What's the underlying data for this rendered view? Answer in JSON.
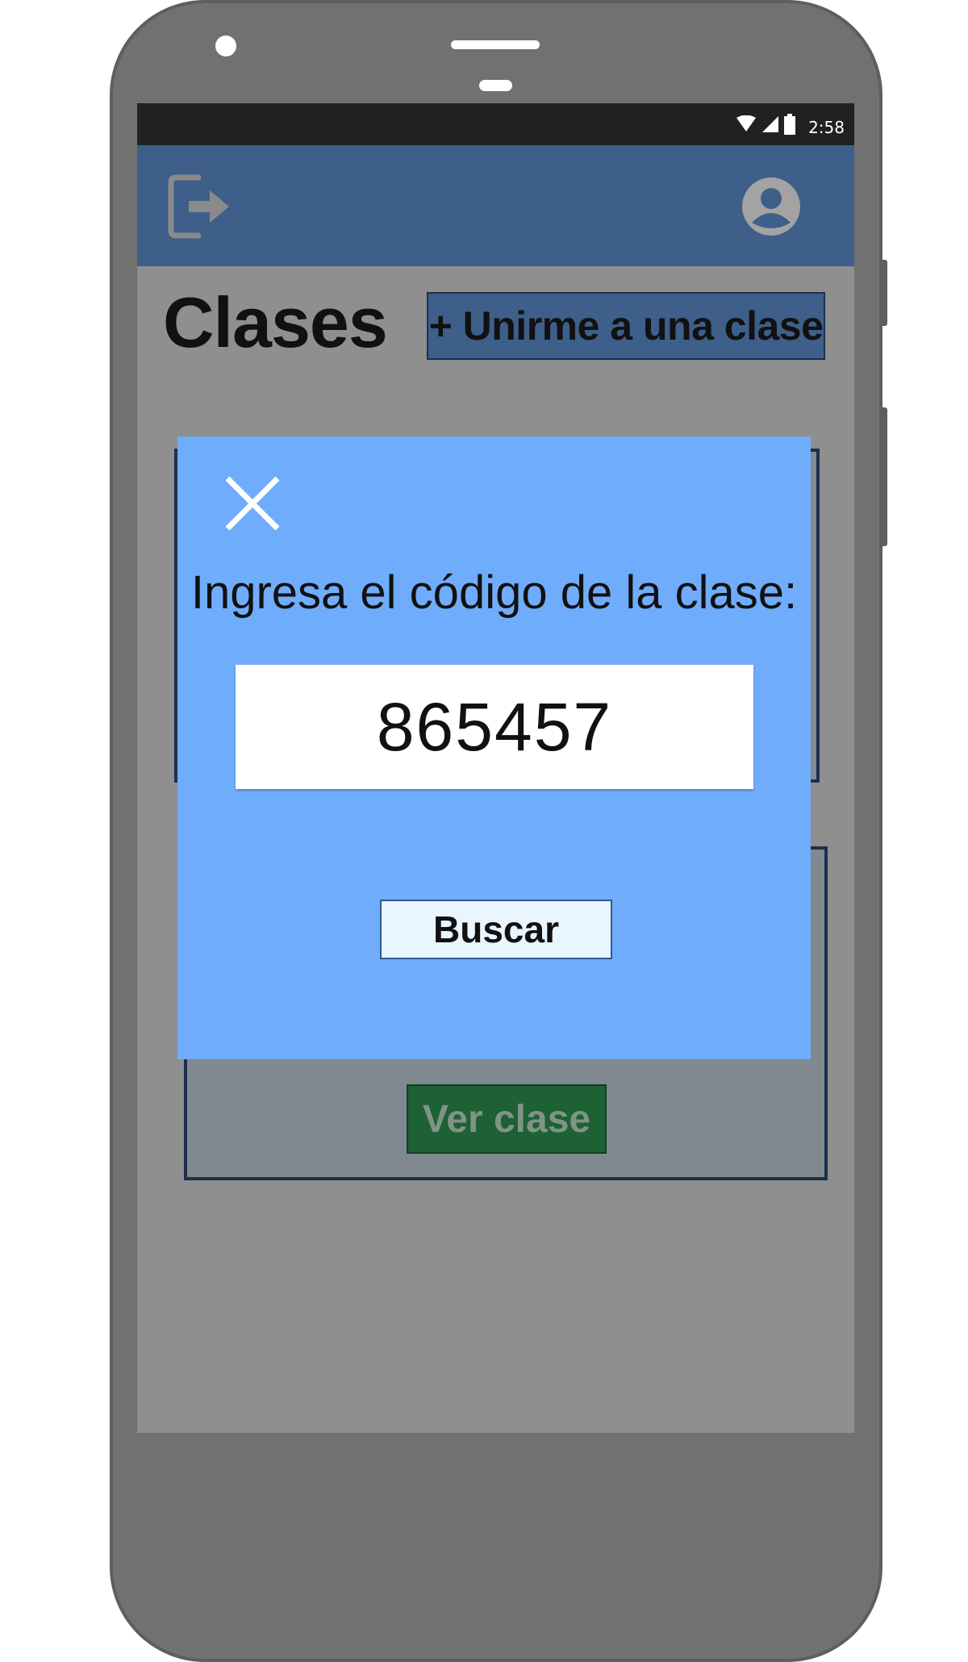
{
  "status_bar": {
    "time": "2:58",
    "icons": [
      "wifi-icon",
      "signal-icon",
      "battery-icon"
    ]
  },
  "app_bar": {
    "left_icon": "logout-icon",
    "right_icon": "account-circle-icon"
  },
  "page": {
    "title": "Clases",
    "join_button_label": "+ Unirme a una clase"
  },
  "cards": {
    "view_class_label": "Ver clase"
  },
  "dialog": {
    "prompt": "Ingresa el código de la clase:",
    "code_value": "865457",
    "search_label": "Buscar",
    "close_icon": "close-icon"
  },
  "colors": {
    "app_bar": "#3d5f8a",
    "dialog_bg": "#70acfc",
    "view_class_button": "#1d6135",
    "search_button_bg": "#e9f5ff"
  }
}
